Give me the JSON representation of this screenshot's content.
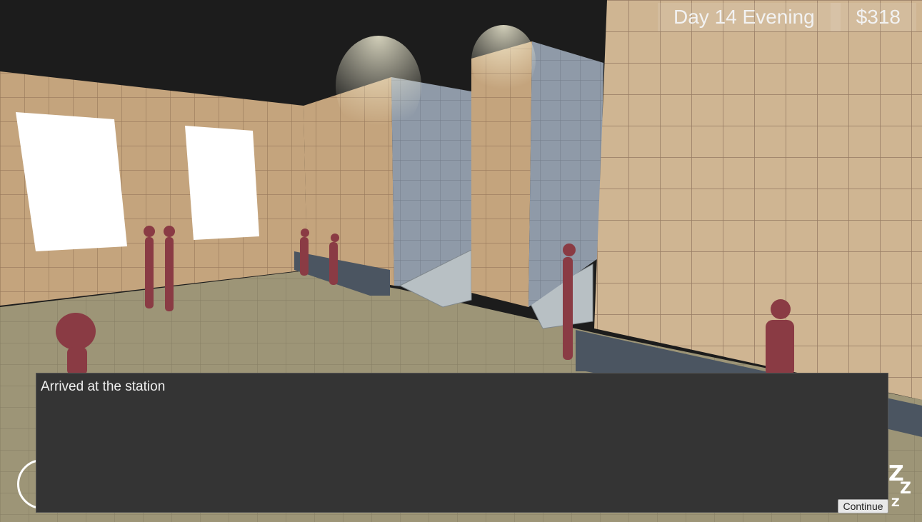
{
  "hud": {
    "day": "Day 14 Evening",
    "money": "$318"
  },
  "dialog": {
    "message": "Arrived at the station",
    "continue_label": "Continue"
  },
  "icons": {
    "sleep": "sleep-zzz-icon",
    "left_control": "circle-control-icon"
  },
  "colors": {
    "ceiling": "#1c1c1c",
    "wall_tile": "#c8a97f",
    "floor_tile": "#a39a7c",
    "character": "#8a3b44",
    "dialog_bg": "#343434"
  }
}
